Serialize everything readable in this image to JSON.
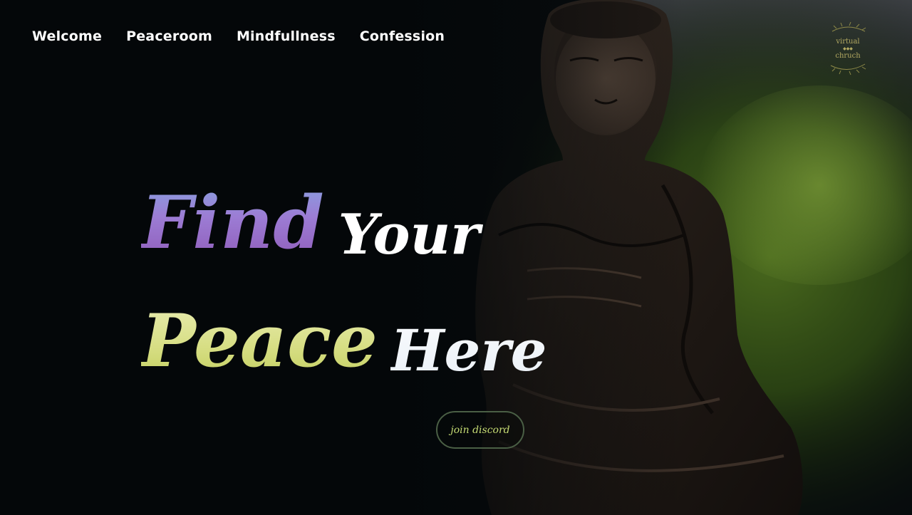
{
  "nav": {
    "items": [
      {
        "label": "Welcome"
      },
      {
        "label": "Peaceroom"
      },
      {
        "label": "Mindfullness"
      },
      {
        "label": "Confession"
      }
    ]
  },
  "logo": {
    "line1": "virtual",
    "dots": "◆◆◆",
    "line2": "chruch"
  },
  "hero": {
    "line1": {
      "word1": "Find",
      "word2": "Your"
    },
    "line2": {
      "word1": "Peace",
      "word2": "Here"
    }
  },
  "cta": {
    "label": "join discord"
  },
  "colors": {
    "find_gradient": [
      "#7fb4e6",
      "#8a4fae"
    ],
    "peace_gradient": [
      "#f0f2c4",
      "#b7c64a"
    ],
    "cta_text": "#c6dc74",
    "cta_border": "#4a5f45",
    "background": "#05080a",
    "foliage": "#4d6e1e"
  }
}
